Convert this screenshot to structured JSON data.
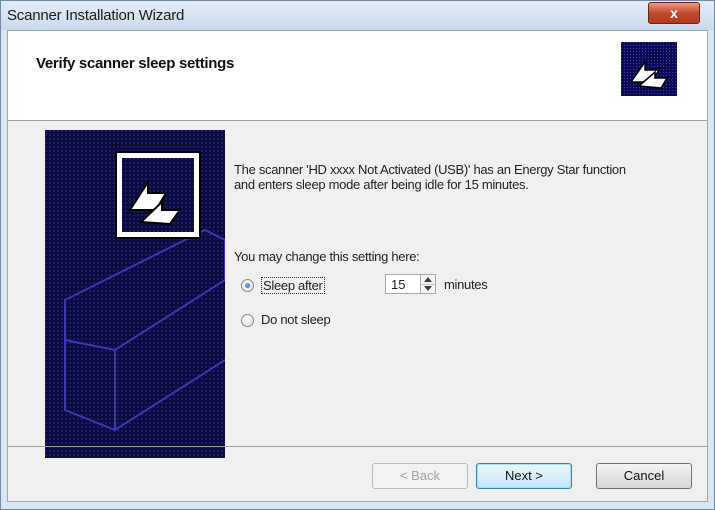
{
  "window": {
    "title": "Scanner Installation Wizard",
    "close_symbol": "x"
  },
  "header": {
    "title": "Verify scanner sleep settings",
    "icon": "scanner-arrows-icon"
  },
  "content": {
    "description": "The scanner 'HD xxxx Not Activated (USB)' has an Energy Star function and enters sleep mode after being idle for 15 minutes.",
    "change_prompt": "You may change this setting here:",
    "options": [
      {
        "label": "Sleep after",
        "selected": true
      },
      {
        "label": "Do not sleep",
        "selected": false
      }
    ],
    "sleep_minutes": "15",
    "minutes_label": "minutes"
  },
  "buttons": {
    "back": "< Back",
    "next": "Next >",
    "cancel": "Cancel"
  },
  "colors": {
    "panel_dark": "#0c0c3d",
    "accent_blue": "#3c7fb1"
  }
}
